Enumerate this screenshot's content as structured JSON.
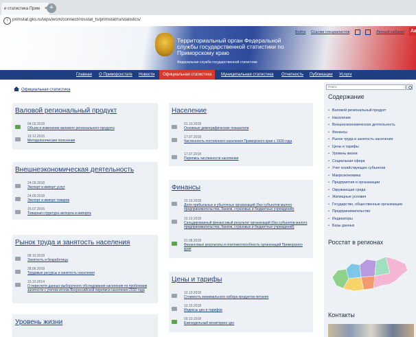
{
  "browser": {
    "tab_title": "и статистика Прим",
    "tab_close": "×",
    "new_tab": "+",
    "info": "i",
    "url": "primstat.gks.ru/wps/wcm/connect/rosstat_ts/primstat/ru/statistics/"
  },
  "header": {
    "org_title": "Территориальный орган Федеральной службы государственной статистики по Приморскому краю",
    "org_subtitle": "Федеральная служба государственной статистики",
    "top_links": [
      "Войти",
      "Ссылки специалистов",
      "Личный кабинет"
    ],
    "aa_label": "Aa"
  },
  "nav": {
    "items": [
      "Главная",
      "О Приморскстате",
      "Новости",
      "Официальная статистика",
      "Муниципальная статистика",
      "Отчетность",
      "Публикации",
      "Услуги"
    ],
    "active": "Официальная статистика"
  },
  "breadcrumb": "Официальная статистика",
  "panels": {
    "vrp": {
      "title": "Валовой региональный продукт",
      "entries": [
        {
          "date": "04.03.2018",
          "link": "Объем и изменение валового регионального продукта",
          "icon": "green"
        },
        {
          "date": "19.12.2016",
          "link": "Методологические пояснения",
          "icon": "gray"
        }
      ]
    },
    "ved": {
      "title": "Внешнеэкономическая деятельность",
      "entries": [
        {
          "date": "24.09.2018",
          "link": "Экспорт и импорт услуг",
          "icon": "gray"
        },
        {
          "date": "24.09.2018",
          "link": "Экспорт и импорт товаров",
          "icon": "gray"
        },
        {
          "date": "15.07.2016",
          "link": "Товарная структура экспорта и импорта",
          "icon": "gray"
        }
      ]
    },
    "trud": {
      "title": "Рынок труда и занятость населения",
      "entries": [
        {
          "date": "08.10.2018",
          "link": "Занятость и безработица",
          "icon": "gray"
        },
        {
          "date": "28.06.2018",
          "link": "Трудовые ресурсы и занятость населения",
          "icon": "gray"
        },
        {
          "date": "15.10.2014",
          "link": "О пересчете данных выборочного обследования населения по проблемам занятости с учетом итогов Всероссийской переписи населения 2010 года",
          "icon": "gray"
        }
      ]
    },
    "uroven": {
      "title": "Уровень жизни"
    },
    "naselenie": {
      "title": "Население",
      "entries": [
        {
          "date": "01.10.2018",
          "link": "Основные демографические показатели",
          "icon": "gray"
        },
        {
          "date": "17.07.2018",
          "link": "Численность постоянного населения Приморского края с 1939 года",
          "icon": "gray"
        },
        {
          "date": "17.07.2018",
          "link": "Перепись численности населения",
          "icon": "gray"
        }
      ]
    },
    "finansy": {
      "title": "Финансы",
      "entries": [
        {
          "date": "10.10.2018",
          "link": "Доля прибыльных и убыточных организаций (без субъектов малого предпринимательства, банков, страховых и бюджетных учреждений)",
          "icon": "gray"
        },
        {
          "date": "10.10.2018",
          "link": "Сальдированный финансовый результат организаций (без субъектов малого предпринимательства, банков, страховых и бюджетных учреждений)",
          "icon": "gray"
        },
        {
          "date": "01.08.2018",
          "link": "Финансовые результаты и платежеспособность организаций Приморского края",
          "icon": "green"
        }
      ]
    },
    "ceny": {
      "title": "Цены и тарифы",
      "entries": [
        {
          "date": "10.10.2018",
          "link": "Стоимость минимального набора продуктов питания",
          "icon": "gray"
        },
        {
          "date": "10.10.2018",
          "link": "Индексы цен и тарифов",
          "icon": "gray"
        },
        {
          "date": "09.10.2018",
          "link": "Еженедельный мониторинг цен",
          "icon": "green"
        }
      ]
    }
  },
  "sidebar": {
    "search_placeholder": "Поиск",
    "contents_heading": "Содержание",
    "items": [
      "Валовой региональный продукт",
      "Население",
      "Внешнеэкономическая деятельность",
      "Финансы",
      "Рынок труда и занятость населения",
      "Цены и тарифы",
      "Уровень жизни",
      "Социальная сфера",
      "Учет хозяйствующих субъектов",
      "Макроэкономика",
      "Предприятия и организации",
      "Окружающая среда",
      "Жилищные условия",
      "Государство, общественные организации",
      "Предпринимательство",
      "Индикаторы",
      "Базы данных"
    ],
    "regions_heading": "Росстат в регионах",
    "contacts_heading": "Контакты"
  },
  "colors": {
    "nav_bg": "#1f3f82",
    "nav_active": "#d63a2c",
    "panel_bg": "#edf1f5",
    "link": "#1a3b7a"
  }
}
